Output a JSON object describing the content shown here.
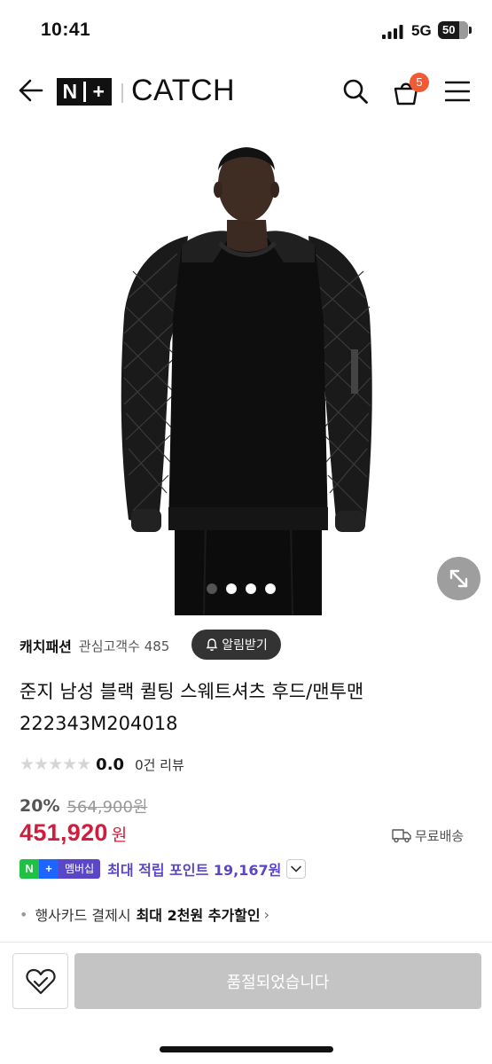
{
  "status_bar": {
    "time": "10:41",
    "network": "5G",
    "battery": "50"
  },
  "header": {
    "logo_left_n": "N",
    "logo_left_plus": "+",
    "logo_brand": "CATCH",
    "cart_count": "5"
  },
  "gallery": {
    "total_images": 4,
    "active_index": 0
  },
  "product": {
    "seller": "캐치패션",
    "interest_label": "관심고객수",
    "interest_count": "485",
    "alarm_button": "알림받기",
    "title_line1": "준지 남성 블랙 퀼팅 스웨트셔츠 후드/맨투맨",
    "title_line2": "222343M204018",
    "stars": "★★★★★",
    "rating_value": 0.0,
    "rating": "0.0",
    "review_count": "0건 리뷰",
    "discount_rate": "20%",
    "original_price": "564,900원",
    "price": "451,920",
    "price_unit": "원",
    "shipping": "무료배송",
    "membership": {
      "badge_n": "N",
      "badge_plus": "+",
      "badge_label": "멤버십",
      "text": "최대 적립 포인트 19,167원"
    },
    "benefit": {
      "bullet": "•",
      "text": "행사카드 결제시",
      "bold": "최대 2천원 추가할인",
      "chevron": "›"
    }
  },
  "bottom": {
    "soldout_label": "품절되었습니다"
  },
  "colors": {
    "price": "#d01d3d",
    "membership": "#5a46c8",
    "badge_green": "#20c045",
    "badge_blue": "#1e64ff",
    "cart_badge": "#f05a35",
    "soldout_button": "#c4c4c4"
  }
}
